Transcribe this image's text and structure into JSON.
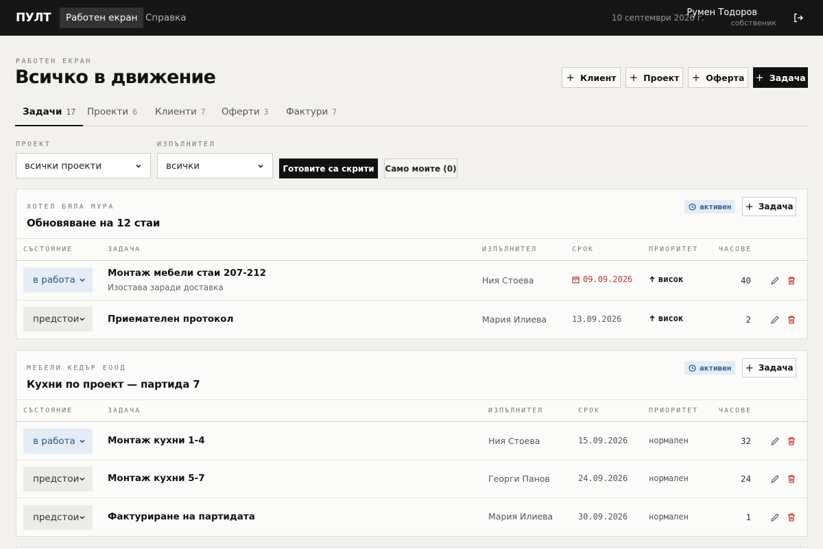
{
  "topbar": {
    "logo": "ПУЛТ",
    "nav": [
      "Работен екран",
      "Справка"
    ],
    "date": "10 септември 2026 г.",
    "user_name": "Румен Тодоров",
    "user_role": "собственик",
    "logout_icon": "logout-icon"
  },
  "header": {
    "eyebrow": "РАБОТЕН ЕКРАН",
    "title": "Всичко в движение",
    "buttons": [
      "Клиент",
      "Проект",
      "Оферта",
      "Задача"
    ]
  },
  "tabs": [
    {
      "label": "Задачи",
      "count": "17"
    },
    {
      "label": "Проекти",
      "count": "6"
    },
    {
      "label": "Клиенти",
      "count": "7"
    },
    {
      "label": "Оферти",
      "count": "3"
    },
    {
      "label": "Фактури",
      "count": "7"
    }
  ],
  "filters": {
    "project_label": "ПРОЕКТ",
    "project_value": "всички проекти",
    "assignee_label": "ИЗПЪЛНИТЕЛ",
    "assignee_value": "всички",
    "hide_done": "Готовите са скрити",
    "only_mine": "Само моите (0)"
  },
  "columns": [
    "СЪСТОЯНИЕ",
    "ЗАДАЧА",
    "ИЗПЪЛНИТЕЛ",
    "СРОК",
    "ПРИОРИТЕТ",
    "ЧАСОВЕ"
  ],
  "projects": [
    {
      "client": "ХОТЕЛ БЯЛА МУРА",
      "title": "Обновяване на 12 стаи",
      "badge": "активен",
      "add_label": "Задача",
      "tasks": [
        {
          "status": "в работа",
          "name": "Монтаж мебели стаи 207-212",
          "note": "Изостава заради доставка",
          "assignee": "Ния Стоева",
          "due": "09.09.2026",
          "priority": "висок",
          "hours": "40"
        },
        {
          "status": "предстои",
          "name": "Приемателен протокол",
          "assignee": "Мария Илиева",
          "due": "13.09.2026",
          "priority": "висок",
          "hours": "2"
        }
      ]
    },
    {
      "client": "МЕБЕЛИ КЕДЪР ЕООД",
      "title": "Кухни по проект — партида 7",
      "badge": "активен",
      "add_label": "Задача",
      "tasks": [
        {
          "status": "в работа",
          "name": "Монтаж кухни 1-4",
          "assignee": "Ния Стоева",
          "due": "15.09.2026",
          "priority": "нормален",
          "hours": "32"
        },
        {
          "status": "предстои",
          "name": "Монтаж кухни 5-7",
          "assignee": "Георги Панов",
          "due": "24.09.2026",
          "priority": "нормален",
          "hours": "24"
        },
        {
          "status": "предстои",
          "name": "Фактуриране на партидата",
          "assignee": "Мария Илиева",
          "due": "30.09.2026",
          "priority": "нормален",
          "hours": "1"
        }
      ]
    }
  ],
  "colors": {
    "topbar": "#161616",
    "background": "#f3f1ed",
    "accent_blue": "#2c5686",
    "danger": "#b03a3a"
  }
}
